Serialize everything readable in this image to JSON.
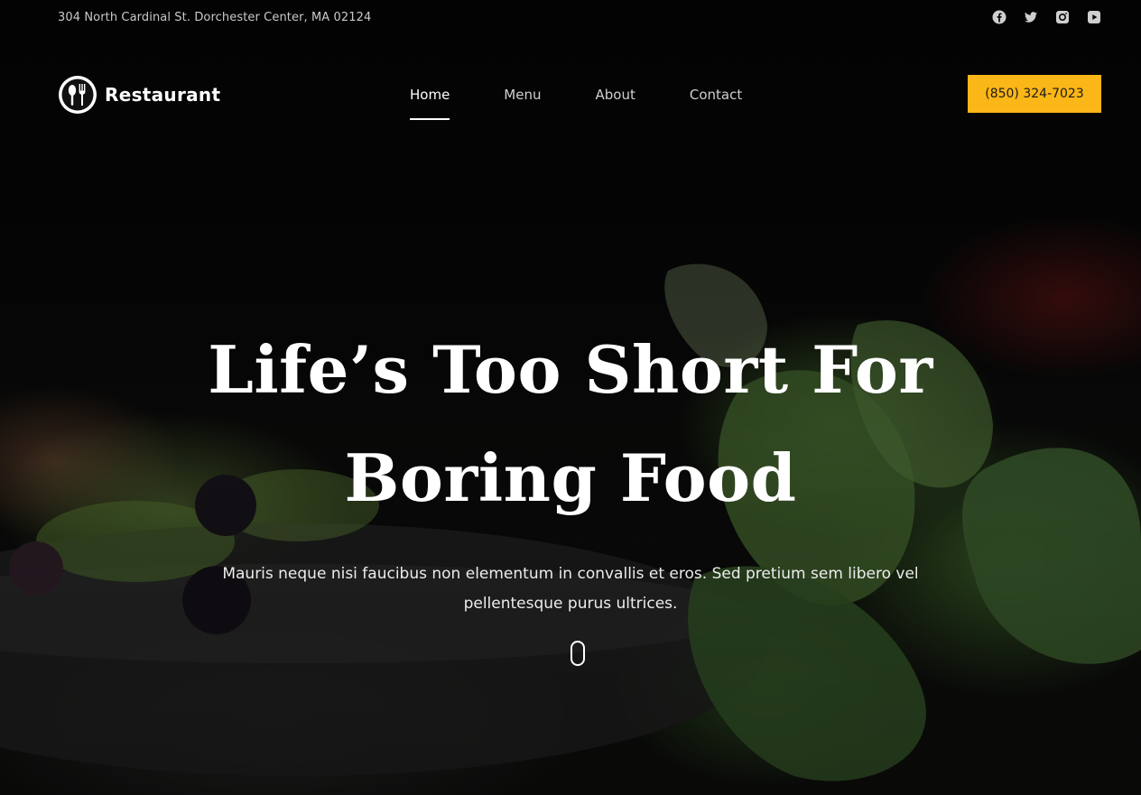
{
  "topbar": {
    "address": "304 North Cardinal St. Dorchester Center, MA 02124",
    "socials": [
      {
        "name": "facebook-icon"
      },
      {
        "name": "twitter-icon"
      },
      {
        "name": "instagram-icon"
      },
      {
        "name": "youtube-icon"
      }
    ]
  },
  "brand": {
    "name": "Restaurant",
    "logo_icon": "fork-spoon-icon"
  },
  "nav": {
    "items": [
      {
        "label": "Home",
        "active": true
      },
      {
        "label": "Menu",
        "active": false
      },
      {
        "label": "About",
        "active": false
      },
      {
        "label": "Contact",
        "active": false
      }
    ]
  },
  "header": {
    "phone_label": "(850) 324-7023",
    "accent_color": "#fbb617"
  },
  "hero": {
    "title_line1": "Life’s Too Short For",
    "title_line2": "Boring Food",
    "subtitle": "Mauris neque nisi faucibus non elementum in convallis et eros. Sed pretium sem libero vel pellentesque purus ultrices.",
    "scroll_icon": "mouse-scroll-icon"
  }
}
